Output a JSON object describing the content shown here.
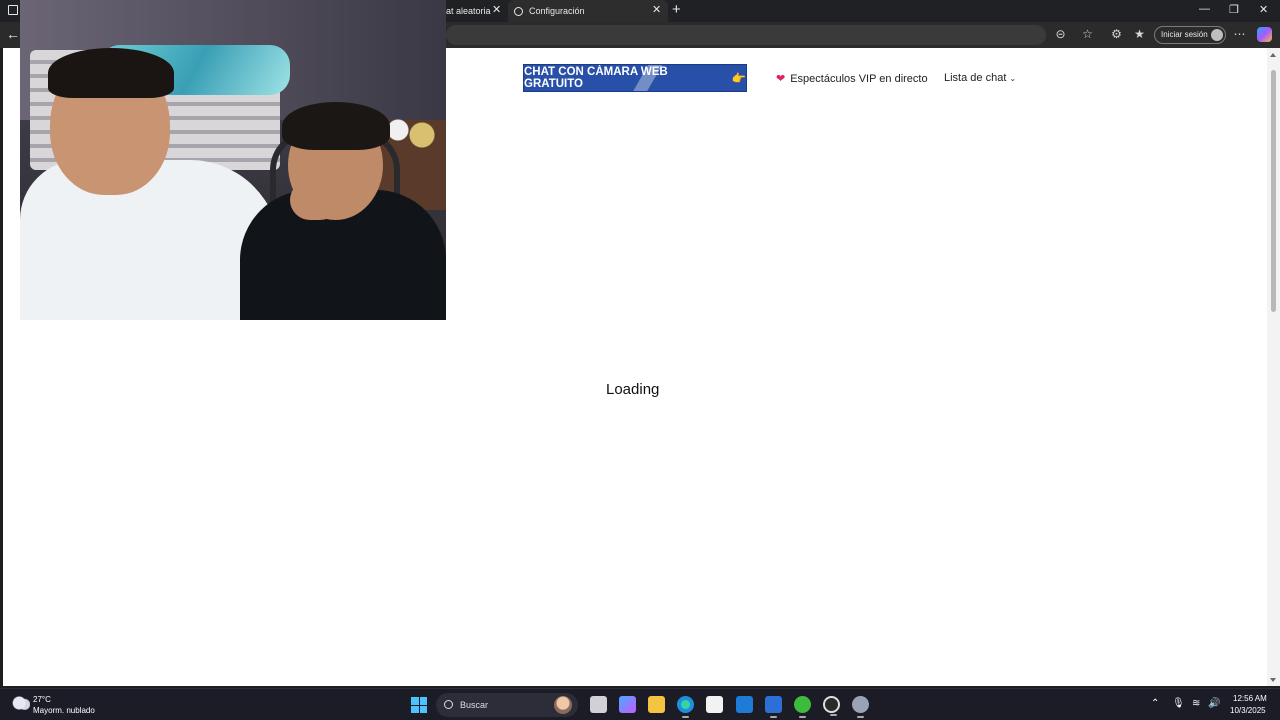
{
  "browser": {
    "tabs": [
      {
        "label": "at aleatoria"
      },
      {
        "label": "Configuración"
      }
    ],
    "new_tab_symbol": "+",
    "sign_in_label": "Iniciar sesión",
    "icons": [
      "window-icon",
      "back-icon",
      "translate-icon",
      "favorite-icon",
      "extensions-icon",
      "favorites-icon",
      "more-icon",
      "copilot-icon"
    ]
  },
  "page": {
    "cta_label": "CHAT CON CÁMARA WEB GRATUITO",
    "cta_emoji": "👉",
    "nav_vip_label": "Espectáculos VIP en directo",
    "nav_list_label": "Lista de chat",
    "loading_text": "Loading"
  },
  "taskbar": {
    "weather_temp": "27°C",
    "weather_desc": "Mayorm. nublado",
    "search_label": "Buscar",
    "clock_time": "12:56 AM",
    "clock_date": "10/3/2025"
  },
  "colors": {
    "cta_bg": "#2850a8",
    "heart": "#e0245e",
    "taskbar_bg": "#1c1c26"
  }
}
